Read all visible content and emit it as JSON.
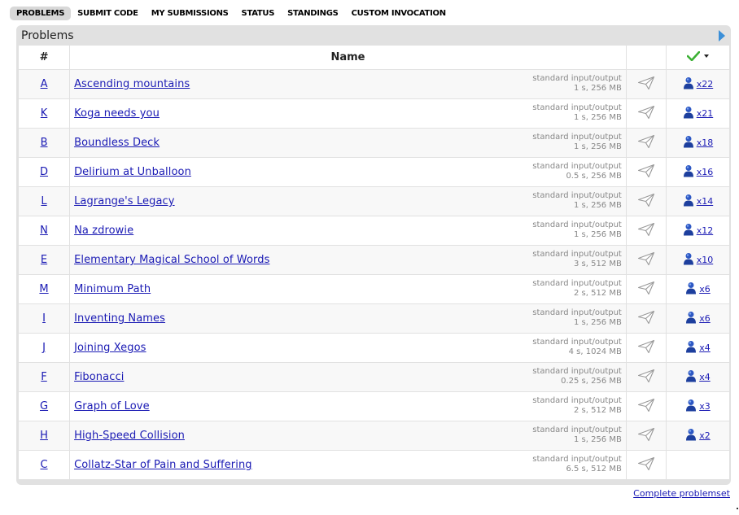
{
  "nav": {
    "items": [
      {
        "label": "PROBLEMS",
        "active": true
      },
      {
        "label": "SUBMIT CODE",
        "active": false
      },
      {
        "label": "MY SUBMISSIONS",
        "active": false
      },
      {
        "label": "STATUS",
        "active": false
      },
      {
        "label": "STANDINGS",
        "active": false
      },
      {
        "label": "CUSTOM INVOCATION",
        "active": false
      }
    ]
  },
  "panel": {
    "title": "Problems"
  },
  "table": {
    "headers": {
      "index": "#",
      "name": "Name"
    },
    "rows": [
      {
        "index": "A",
        "name": "Ascending mountains",
        "io": "standard input/output",
        "limits": "1 s, 256 MB",
        "solved": "x22"
      },
      {
        "index": "K",
        "name": "Koga needs you",
        "io": "standard input/output",
        "limits": "1 s, 256 MB",
        "solved": "x21"
      },
      {
        "index": "B",
        "name": "Boundless Deck",
        "io": "standard input/output",
        "limits": "1 s, 256 MB",
        "solved": "x18"
      },
      {
        "index": "D",
        "name": "Delirium at Unballoon",
        "io": "standard input/output",
        "limits": "0.5 s, 256 MB",
        "solved": "x16"
      },
      {
        "index": "L",
        "name": "Lagrange's Legacy",
        "io": "standard input/output",
        "limits": "1 s, 256 MB",
        "solved": "x14"
      },
      {
        "index": "N",
        "name": "Na zdrowie",
        "io": "standard input/output",
        "limits": "1 s, 256 MB",
        "solved": "x12"
      },
      {
        "index": "E",
        "name": "Elementary Magical School of Words",
        "io": "standard input/output",
        "limits": "3 s, 512 MB",
        "solved": "x10"
      },
      {
        "index": "M",
        "name": "Minimum Path",
        "io": "standard input/output",
        "limits": "2 s, 512 MB",
        "solved": "x6"
      },
      {
        "index": "I",
        "name": "Inventing Names",
        "io": "standard input/output",
        "limits": "1 s, 256 MB",
        "solved": "x6"
      },
      {
        "index": "J",
        "name": "Joining Xegos",
        "io": "standard input/output",
        "limits": "4 s, 1024 MB",
        "solved": "x4"
      },
      {
        "index": "F",
        "name": "Fibonacci",
        "io": "standard input/output",
        "limits": "0.25 s, 256 MB",
        "solved": "x4"
      },
      {
        "index": "G",
        "name": "Graph of Love",
        "io": "standard input/output",
        "limits": "2 s, 512 MB",
        "solved": "x3"
      },
      {
        "index": "H",
        "name": "High-Speed Collision",
        "io": "standard input/output",
        "limits": "1 s, 256 MB",
        "solved": "x2"
      },
      {
        "index": "C",
        "name": "Collatz-Star of Pain and Suffering",
        "io": "standard input/output",
        "limits": "6.5 s, 512 MB",
        "solved": ""
      }
    ]
  },
  "footer": {
    "complete_link": "Complete problemset"
  },
  "icons": {
    "send": "paper-plane-icon",
    "solved": "user-icon",
    "header": "green-check-icon"
  },
  "colors": {
    "link": "#1a1ab4",
    "panel_bg": "#e1e1e1",
    "check": "#3cb034",
    "user_icon": "#2d58c4"
  }
}
